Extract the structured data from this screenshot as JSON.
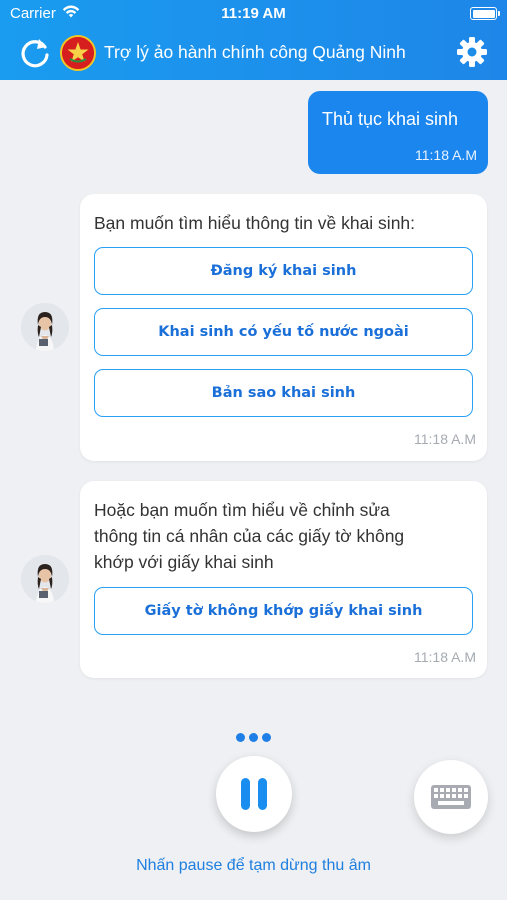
{
  "status_bar": {
    "carrier": "Carrier",
    "time": "11:19 AM"
  },
  "header": {
    "title": "Trợ lý ảo hành chính công Quảng Ninh"
  },
  "colors": {
    "primary": "#1a86ee",
    "header_gradient_start": "#1a9cf0",
    "background": "#eef0f3"
  },
  "icons": {
    "refresh": "refresh-icon",
    "logo": "province-logo",
    "settings": "gear-icon",
    "pause": "pause-icon",
    "keyboard": "keyboard-icon"
  },
  "messages": [
    {
      "type": "user",
      "text": "Thủ tục khai sinh",
      "time": "11:18 A.M"
    },
    {
      "type": "bot",
      "text": "Bạn muốn tìm hiểu thông tin về khai sinh:",
      "options": [
        "Đăng ký khai sinh",
        "Khai sinh có yếu tố nước ngoài",
        "Bản sao khai sinh"
      ],
      "time": "11:18 A.M"
    },
    {
      "type": "bot",
      "lines": [
        "Hoặc bạn muốn tìm hiểu về chỉnh sửa",
        "thông tin cá nhân của các giấy tờ không",
        "khớp với giấy khai sinh"
      ],
      "options": [
        "Giấy tờ không khớp giấy khai sinh"
      ],
      "time": "11:18 A.M"
    }
  ],
  "footer": {
    "hint": "Nhấn pause để tạm dừng thu âm"
  }
}
